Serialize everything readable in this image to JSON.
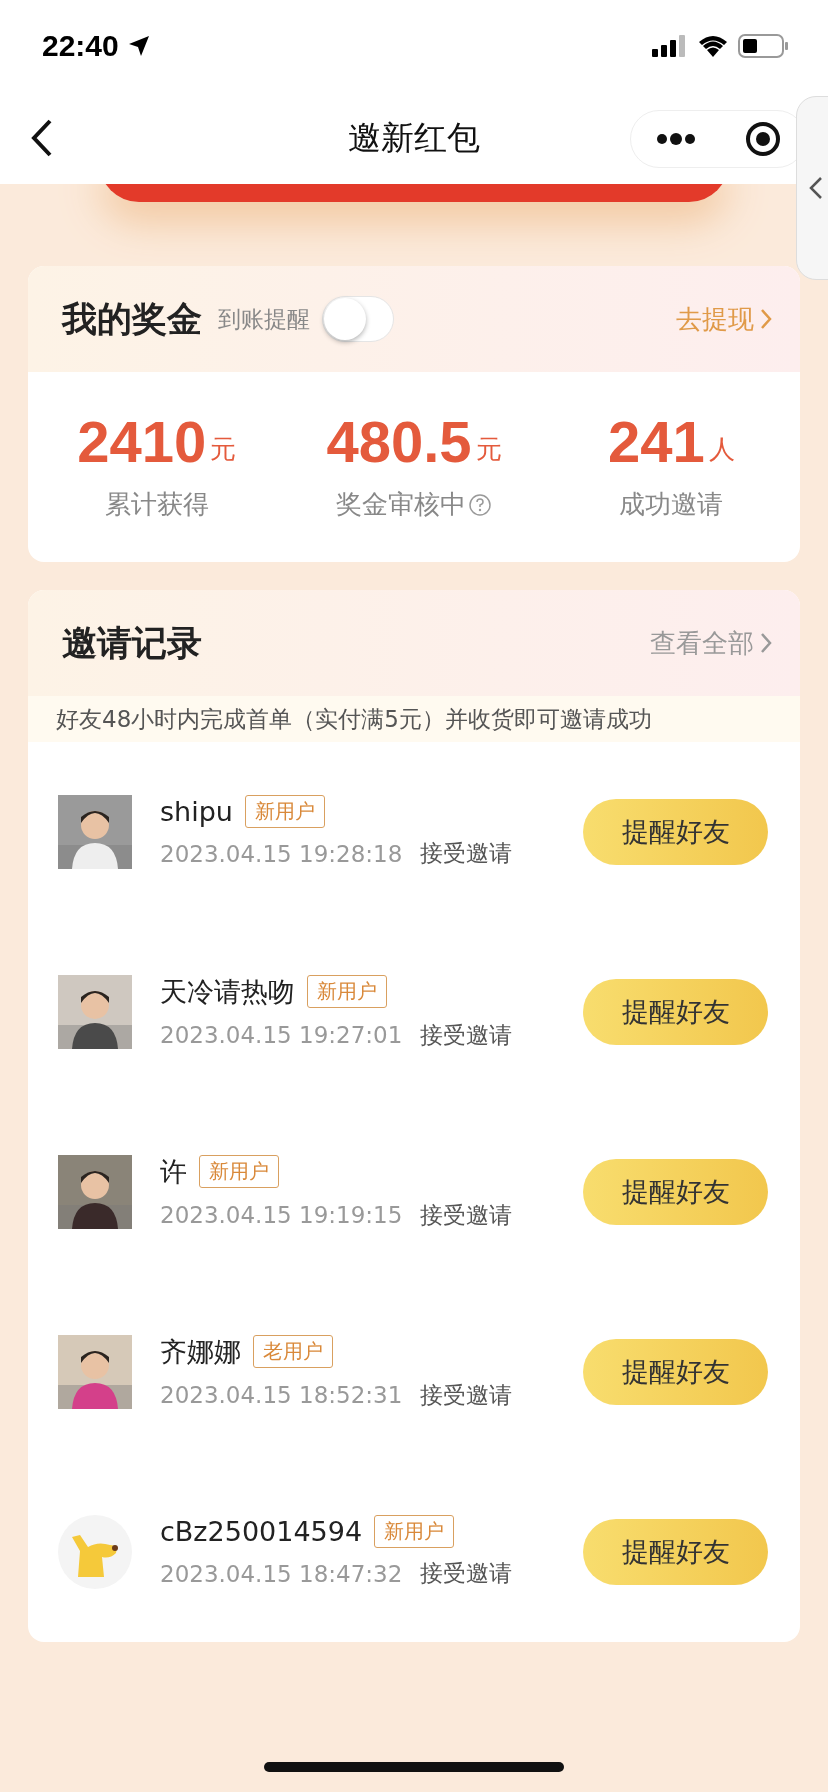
{
  "status_bar": {
    "time": "22:40"
  },
  "nav": {
    "title": "邀新红包"
  },
  "bonus": {
    "title": "我的奖金",
    "reminder_label": "到账提醒",
    "reminder_on": false,
    "withdraw": "去提现",
    "stats": [
      {
        "value": "2410",
        "unit": "元",
        "label": "累计获得",
        "help": false
      },
      {
        "value": "480.5",
        "unit": "元",
        "label": "奖金审核中",
        "help": true
      },
      {
        "value": "241",
        "unit": "人",
        "label": "成功邀请",
        "help": false
      }
    ]
  },
  "records": {
    "title": "邀请记录",
    "view_all": "查看全部",
    "notice": "好友48小时内完成首单（实付满5元）并收货即可邀请成功",
    "items": [
      {
        "name": "shipu",
        "badge": "新用户",
        "time": "2023.04.15 19:28:18",
        "status": "接受邀请",
        "button": "提醒好友",
        "kind": "picture"
      },
      {
        "name": "天冷请热吻",
        "badge": "新用户",
        "time": "2023.04.15 19:27:01",
        "status": "接受邀请",
        "button": "提醒好友",
        "kind": "picture"
      },
      {
        "name": "许",
        "badge": "新用户",
        "time": "2023.04.15 19:19:15",
        "status": "接受邀请",
        "button": "提醒好友",
        "kind": "picture"
      },
      {
        "name": "齐娜娜",
        "badge": "老用户",
        "time": "2023.04.15 18:52:31",
        "status": "接受邀请",
        "button": "提醒好友",
        "kind": "picture"
      },
      {
        "name": "cBz250014594",
        "badge": "新用户",
        "time": "2023.04.15 18:47:32",
        "status": "接受邀请",
        "button": "提醒好友",
        "kind": "avatar"
      }
    ]
  }
}
